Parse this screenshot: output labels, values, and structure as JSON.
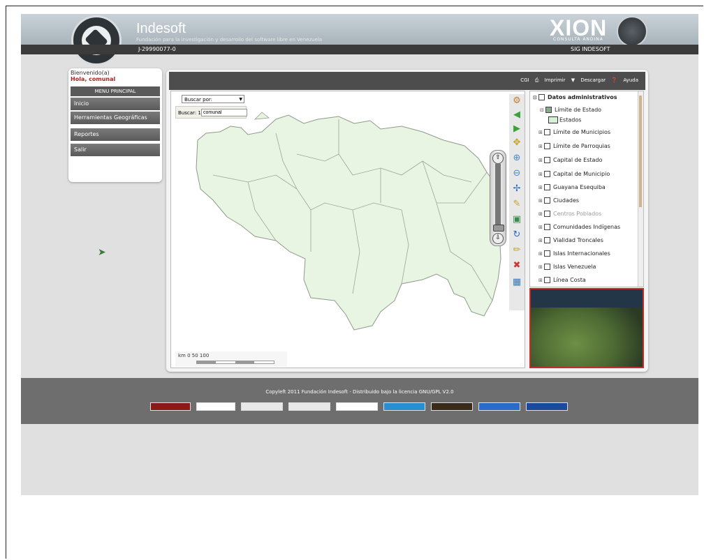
{
  "header": {
    "brand": "Indesoft",
    "subtitle": "Fundación para la investigación y desarrollo del software libre en Venezuela",
    "rif": "J-29990077-0",
    "partner": "XION",
    "partner_sub": "CONSULTA ANDINA",
    "product": "SIG INDESOFT"
  },
  "menu": {
    "welcome": "Bienvenido(a)",
    "user": "Hola, comunal",
    "title": "MENU PRINCIPAL",
    "items": [
      {
        "label": "Inicio"
      },
      {
        "label": "Herramientas Geográficas"
      },
      {
        "label": "Reportes"
      },
      {
        "label": "Salir"
      }
    ]
  },
  "toolbar": {
    "links": [
      "CGI",
      "Imprimir",
      "Descargar",
      "Ayuda"
    ]
  },
  "map": {
    "search_select": "Buscar por:",
    "search_label": "Buscar: 1",
    "search_value": "comunal",
    "scale_text": "km  0        50        100",
    "map_color": "#e8f5e3"
  },
  "layers": {
    "root": "Datos administrativos",
    "items": [
      {
        "label": "Límite de Estado",
        "checked": true,
        "expanded": true
      },
      {
        "label": "Estados",
        "legend": true
      },
      {
        "label": "Límite de Municipios"
      },
      {
        "label": "Límite de Parroquias"
      },
      {
        "label": "Capital de Estado"
      },
      {
        "label": "Capital de Municipio"
      },
      {
        "label": "Guayana Esequiba"
      },
      {
        "label": "Ciudades"
      },
      {
        "label": "Centros Poblados"
      },
      {
        "label": "Comunidades Indígenas"
      },
      {
        "label": "Vialidad Troncales"
      },
      {
        "label": "Islas Internacionales"
      },
      {
        "label": "Islas Venezuela"
      },
      {
        "label": "Línea Costa"
      }
    ]
  },
  "footer": {
    "copyright": "Copyleft 2011 Fundación Indesoft - Distribuido bajo la licencia GNU/GPL V2.0",
    "logos": [
      "",
      "",
      "",
      "",
      "",
      "",
      "",
      "",
      ""
    ]
  }
}
